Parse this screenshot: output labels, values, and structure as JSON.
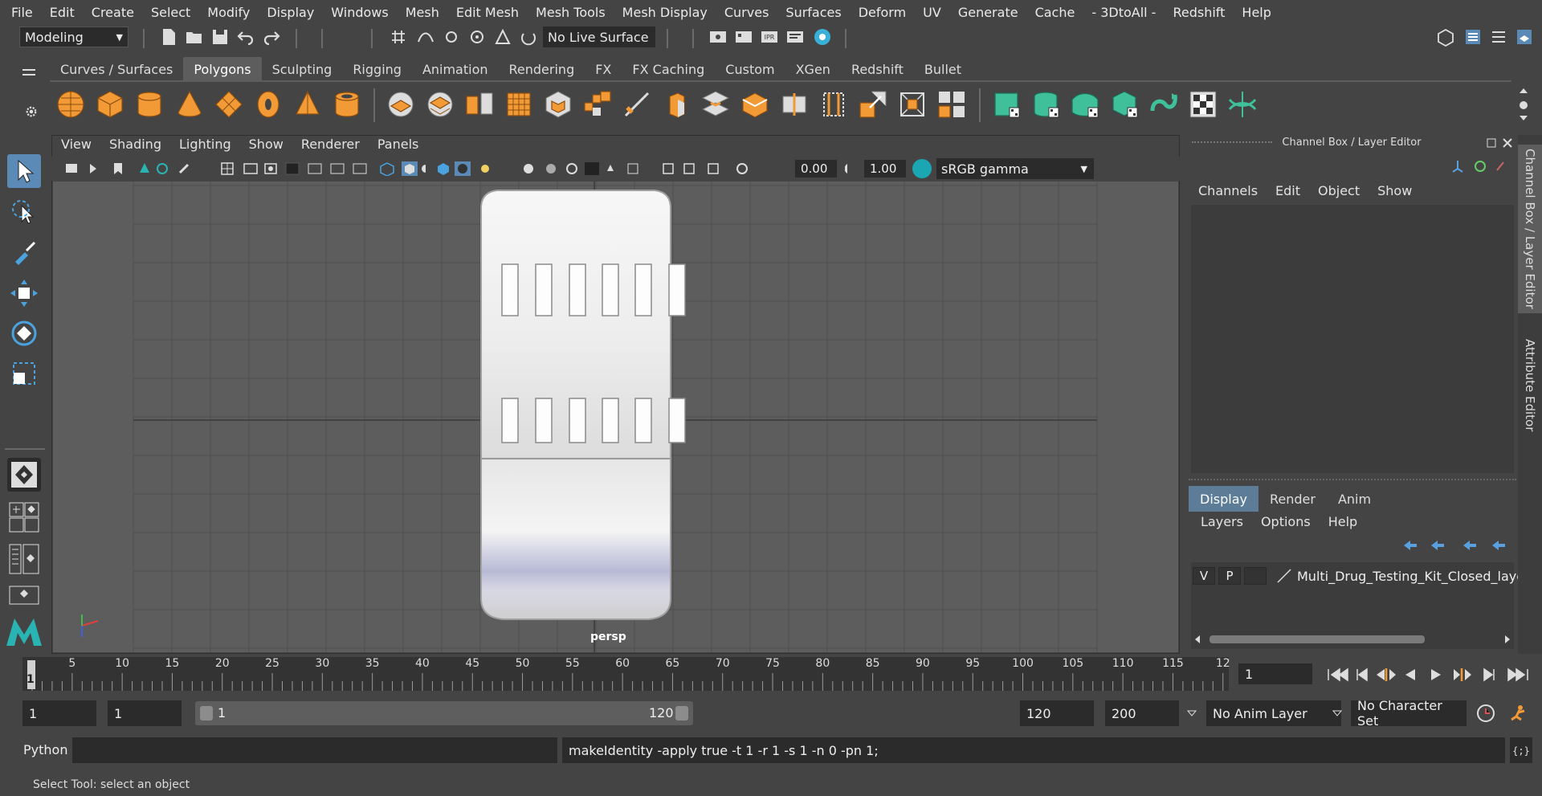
{
  "menubar": [
    "File",
    "Edit",
    "Create",
    "Select",
    "Modify",
    "Display",
    "Windows",
    "Mesh",
    "Edit Mesh",
    "Mesh Tools",
    "Mesh Display",
    "Curves",
    "Surfaces",
    "Deform",
    "UV",
    "Generate",
    "Cache",
    "- 3DtoAll -",
    "Redshift",
    "Help"
  ],
  "status": {
    "mode": "Modeling",
    "live_surface": "No Live Surface"
  },
  "shelf": {
    "tabs": [
      "Curves / Surfaces",
      "Polygons",
      "Sculpting",
      "Rigging",
      "Animation",
      "Rendering",
      "FX",
      "FX Caching",
      "Custom",
      "XGen",
      "Redshift",
      "Bullet"
    ],
    "active": "Polygons"
  },
  "viewport": {
    "menu": [
      "View",
      "Shading",
      "Lighting",
      "Show",
      "Renderer",
      "Panels"
    ],
    "exposure": "0.00",
    "gamma": "1.00",
    "color_space": "sRGB gamma",
    "camera": "persp"
  },
  "right_panel": {
    "title": "Channel Box / Layer Editor",
    "cb_menu": [
      "Channels",
      "Edit",
      "Object",
      "Show"
    ],
    "le_tabs": [
      "Display",
      "Render",
      "Anim"
    ],
    "le_menu": [
      "Layers",
      "Options",
      "Help"
    ],
    "layer": {
      "v": "V",
      "p": "P",
      "name": "Multi_Drug_Testing_Kit_Closed_layer"
    },
    "vtabs": [
      "Channel Box / Layer Editor",
      "Attribute Editor"
    ]
  },
  "timeline": {
    "ticks": [
      "5",
      "10",
      "15",
      "20",
      "25",
      "30",
      "35",
      "40",
      "45",
      "50",
      "55",
      "60",
      "65",
      "70",
      "75",
      "80",
      "85",
      "90",
      "95",
      "100",
      "105",
      "110",
      "115",
      "12"
    ],
    "current_frame_marker": "1",
    "current_frame": "1"
  },
  "range": {
    "start": "1",
    "anim_start": "1",
    "slider_start": "1",
    "slider_end": "120",
    "anim_end": "120",
    "end": "200",
    "anim_layer": "No Anim Layer",
    "char_set": "No Character Set"
  },
  "command": {
    "language": "Python",
    "input": "",
    "result": "makeIdentity -apply true -t 1 -r 1 -s 1 -n 0 -pn 1;"
  },
  "help_line": "Select Tool: select an object",
  "colors": {
    "accent": "#5a8ab5",
    "shelf_orange": "#f29a35",
    "shelf_teal": "#3fbf9a",
    "viewport_bg": "#5d5d5d"
  }
}
